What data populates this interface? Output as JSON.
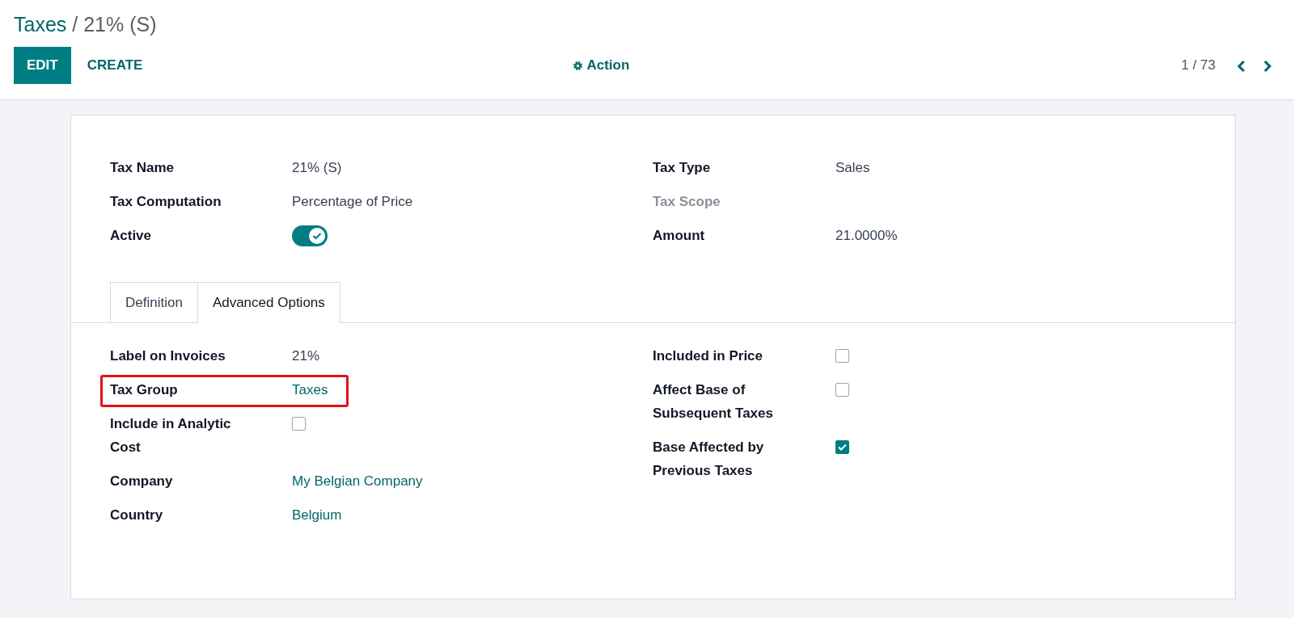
{
  "breadcrumb": [
    {
      "label": "Taxes",
      "kind": "link"
    },
    {
      "label": "/ 21% (S)",
      "kind": "current"
    }
  ],
  "buttons": [
    {
      "label": "EDIT",
      "kind": "primary"
    },
    {
      "label": "CREATE",
      "kind": "secondary"
    }
  ],
  "action": {
    "label": "Action"
  },
  "pager": {
    "text": "1 / 73"
  },
  "main_fields": {
    "left": [
      {
        "label": "Tax Name",
        "value": "21% (S)",
        "kind": "text",
        "muted": false
      },
      {
        "label": "Tax Computation",
        "value": "Percentage of Price",
        "kind": "text",
        "muted": false
      },
      {
        "label": "Active",
        "kind": "toggle",
        "on": true,
        "muted": false
      }
    ],
    "right": [
      {
        "label": "Tax Type",
        "value": "Sales",
        "kind": "text",
        "muted": false
      },
      {
        "label": "Tax Scope",
        "kind": "empty",
        "muted": true
      },
      {
        "label": "Amount",
        "value": "21.0000%",
        "kind": "text",
        "muted": false
      }
    ]
  },
  "tabs": [
    {
      "label": "Definition",
      "selected": false
    },
    {
      "label": "Advanced Options",
      "selected": true
    }
  ],
  "tab_fields": {
    "left": [
      {
        "label": "Label on Invoices",
        "value": "21%",
        "kind": "text",
        "highlighted": false
      },
      {
        "label": "Tax Group",
        "value": "Taxes",
        "kind": "link",
        "highlighted": true
      },
      {
        "label": "Include in Analytic Cost",
        "kind": "checkbox",
        "checked": false,
        "highlighted": false
      },
      {
        "label": "Company",
        "value": "My Belgian Company",
        "kind": "link",
        "highlighted": false
      },
      {
        "label": "Country",
        "value": "Belgium",
        "kind": "link",
        "highlighted": false
      }
    ],
    "right": [
      {
        "label": "Included in Price",
        "kind": "checkbox",
        "checked": false,
        "highlighted": false
      },
      {
        "label": "Affect Base of Subsequent Taxes",
        "kind": "checkbox",
        "checked": false,
        "highlighted": false
      },
      {
        "label": "Base Affected by Previous Taxes",
        "kind": "checkbox",
        "checked": true,
        "highlighted": false
      }
    ]
  }
}
